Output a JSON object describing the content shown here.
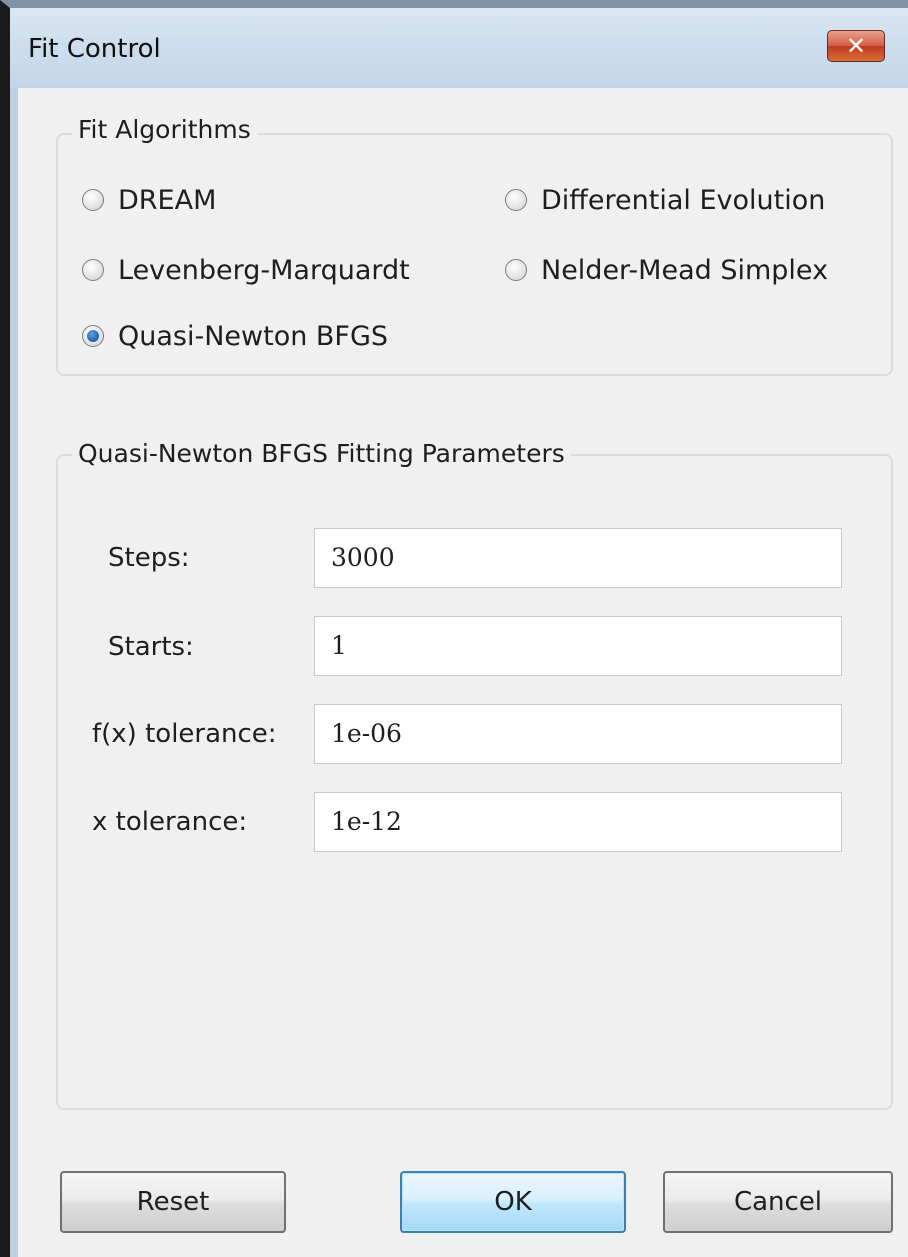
{
  "window": {
    "title": "Fit Control",
    "close_glyph": "✕"
  },
  "algorithms": {
    "legend": "Fit Algorithms",
    "options": [
      {
        "label": "DREAM",
        "selected": false
      },
      {
        "label": "Differential Evolution",
        "selected": false
      },
      {
        "label": "Levenberg-Marquardt",
        "selected": false
      },
      {
        "label": "Nelder-Mead Simplex",
        "selected": false
      },
      {
        "label": "Quasi-Newton BFGS",
        "selected": true
      }
    ]
  },
  "parameters": {
    "legend": "Quasi-Newton BFGS Fitting Parameters",
    "fields": [
      {
        "label": "Steps:",
        "value": "3000"
      },
      {
        "label": "Starts:",
        "value": "1"
      },
      {
        "label": "f(x) tolerance:",
        "value": "1e-06"
      },
      {
        "label": "x tolerance:",
        "value": "1e-12"
      }
    ]
  },
  "buttons": {
    "reset": "Reset",
    "ok": "OK",
    "cancel": "Cancel"
  },
  "icons": {
    "close": "close-icon",
    "radio": "radio-icon"
  },
  "colors": {
    "close_button": "#c0391f",
    "default_button_border": "#3c7fb1",
    "dialog_background": "#f0f0f0"
  }
}
